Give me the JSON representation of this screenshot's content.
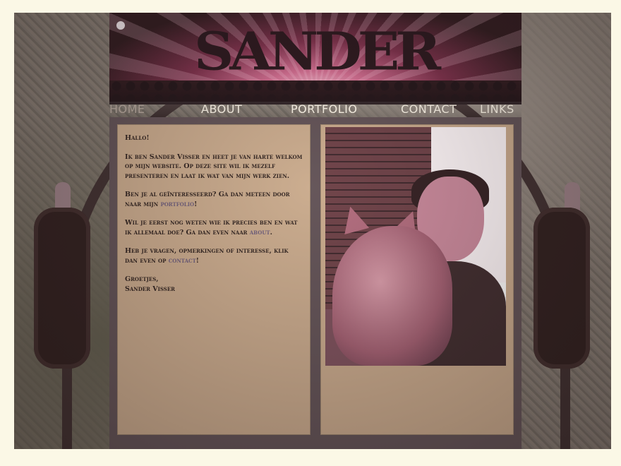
{
  "header": {
    "logo_text": "SANDER"
  },
  "nav": {
    "items": [
      {
        "label": "HOME",
        "active": true
      },
      {
        "label": "ABOUT",
        "active": false
      },
      {
        "label": "PORTFOLIO",
        "active": false
      },
      {
        "label": "CONTACT",
        "active": false
      },
      {
        "label": "LINKS",
        "active": false
      }
    ]
  },
  "content": {
    "greeting": "Hallo!",
    "p1": "Ik ben Sander Visser en heet je van harte welkom op mijn website. Op deze site wil ik mezelf presenteren en laat ik wat van mijn werk zien.",
    "p2_before": "Ben je al geïnteresseerd? Ga dan meteen door naar mijn ",
    "p2_link": "portfolio",
    "p2_after": "!",
    "p3_before": "Wil je eerst nog weten wie ik precies ben en wat ik allemaal doe? Ga dan even naar ",
    "p3_link": "about",
    "p3_after": ".",
    "p4_before": "Heb je vragen, opmerkingen of interesse, klik dan even op ",
    "p4_link": "contact",
    "p4_after": "!",
    "signoff": "Groetjes,",
    "signature": "Sander Visser"
  },
  "colors": {
    "panel": "#c9a98a",
    "frame": "#5e4e52",
    "link": "#6b5a78",
    "nav_text": "#fff8ea",
    "nav_active": "#b5a79c"
  }
}
